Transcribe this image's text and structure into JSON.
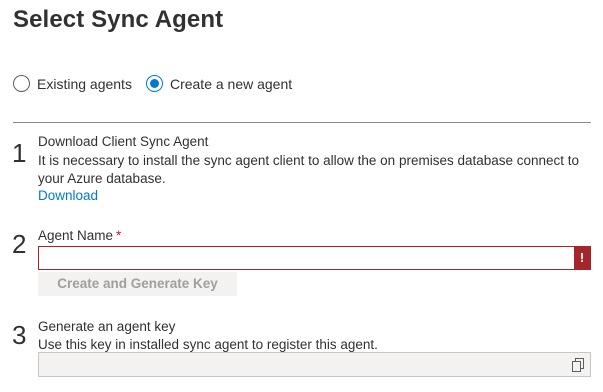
{
  "page": {
    "title": "Select Sync Agent"
  },
  "agent_mode": {
    "options": [
      {
        "label": "Existing agents",
        "checked": false
      },
      {
        "label": "Create a new agent",
        "checked": true
      }
    ]
  },
  "steps": [
    {
      "number": "1",
      "heading": "Download Client Sync Agent",
      "description_line1": "It is necessary to install the sync agent client to allow the on premises database connect to",
      "description_line2": "your Azure database.",
      "link": "Download"
    },
    {
      "number": "2",
      "label": "Agent Name",
      "required_marker": "*",
      "input_value": "",
      "error_marker": "!",
      "button_label": "Create and Generate Key"
    },
    {
      "number": "3",
      "heading": "Generate an agent key",
      "description": "Use this key in installed sync agent to register this agent.",
      "key_value": "",
      "copy_icon": "copy-icon"
    }
  ],
  "colors": {
    "accent": "#0078d4",
    "error": "#a4262c",
    "disabled_text": "#a19f9d"
  }
}
